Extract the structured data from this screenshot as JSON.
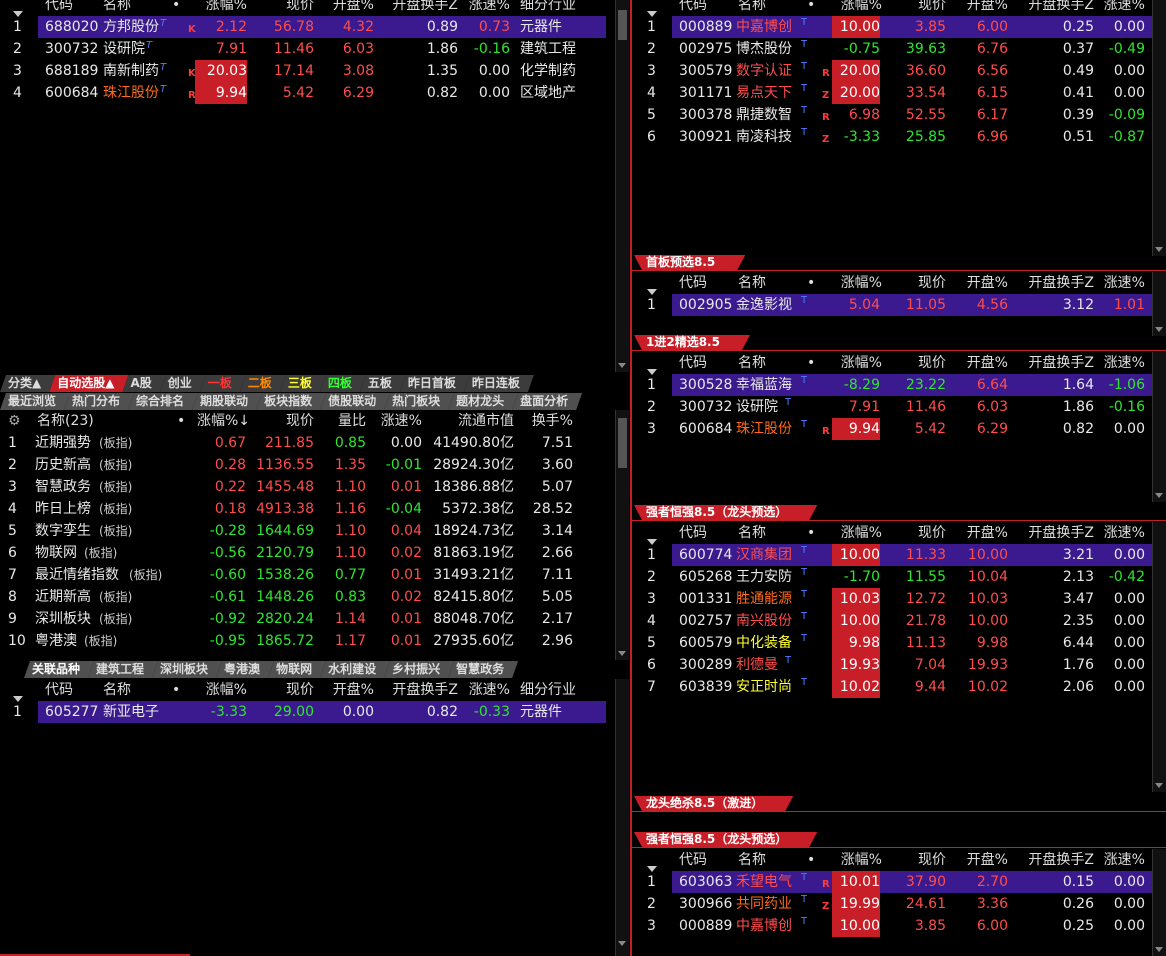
{
  "headers": {
    "code": "代码",
    "name": "名称",
    "dot": "•",
    "chg": "涨幅%",
    "price": "现价",
    "open": "开盘%",
    "turnover": "开盘换手Z",
    "speed": "涨速%",
    "industry": "细分行业"
  },
  "topLeft": {
    "rows": [
      {
        "idx": "1",
        "code": "688020",
        "name": "方邦股份",
        "flag": "K",
        "chg": "2.12",
        "price": "56.78",
        "open": "4.32",
        "turnover": "0.89",
        "speed": "0.73",
        "industry": "元器件"
      },
      {
        "idx": "2",
        "code": "300732",
        "name": "设研院",
        "flag": "",
        "chg": "7.91",
        "price": "11.46",
        "open": "6.03",
        "turnover": "1.86",
        "speed": "-0.16",
        "industry": "建筑工程"
      },
      {
        "idx": "3",
        "code": "688189",
        "name": "南新制药",
        "flag": "K",
        "chg": "20.03",
        "price": "17.14",
        "open": "3.08",
        "turnover": "1.35",
        "speed": "0.00",
        "industry": "化学制药"
      },
      {
        "idx": "4",
        "code": "600684",
        "name": "珠江股份",
        "flag": "R",
        "chg": "9.94",
        "price": "5.42",
        "open": "6.29",
        "turnover": "0.82",
        "speed": "0.00",
        "industry": "区域地产"
      }
    ]
  },
  "tabs1": [
    "分类▲",
    "自动选股▲",
    "A股",
    "创业",
    "一板",
    "二板",
    "三板",
    "四板",
    "五板",
    "昨日首板",
    "昨日连板"
  ],
  "tabs2": [
    "最近浏览",
    "热门分布",
    "综合排名",
    "期股联动",
    "板块指数",
    "债股联动",
    "热门板块",
    "题材龙头",
    "盘面分析"
  ],
  "sector": {
    "header": {
      "name": "名称(23)",
      "dot": "•",
      "chg": "涨幅%↓",
      "price": "现价",
      "ratio": "量比",
      "speed": "涨速%",
      "cap": "流通市值",
      "turn": "换手%"
    },
    "tag": "(板指)",
    "rows": [
      {
        "idx": "1",
        "name": "近期强势",
        "chg": "0.67",
        "price": "211.85",
        "ratio": "0.85",
        "speed": "0.00",
        "cap": "41490.80亿",
        "turn": "7.51"
      },
      {
        "idx": "2",
        "name": "历史新高",
        "chg": "0.28",
        "price": "1136.55",
        "ratio": "1.35",
        "speed": "-0.01",
        "cap": "28924.30亿",
        "turn": "3.60"
      },
      {
        "idx": "3",
        "name": "智慧政务",
        "chg": "0.22",
        "price": "1455.48",
        "ratio": "1.10",
        "speed": "0.01",
        "cap": "18386.88亿",
        "turn": "5.07"
      },
      {
        "idx": "4",
        "name": "昨日上榜",
        "chg": "0.18",
        "price": "4913.38",
        "ratio": "1.16",
        "speed": "-0.04",
        "cap": "5372.38亿",
        "turn": "28.52"
      },
      {
        "idx": "5",
        "name": "数字孪生",
        "chg": "-0.28",
        "price": "1644.69",
        "ratio": "1.10",
        "speed": "0.04",
        "cap": "18924.73亿",
        "turn": "3.14"
      },
      {
        "idx": "6",
        "name": "物联网",
        "chg": "-0.56",
        "price": "2120.79",
        "ratio": "1.10",
        "speed": "0.02",
        "cap": "81863.19亿",
        "turn": "2.66"
      },
      {
        "idx": "7",
        "name": "最近情绪指数",
        "chg": "-0.60",
        "price": "1538.26",
        "ratio": "0.77",
        "speed": "0.01",
        "cap": "31493.21亿",
        "turn": "7.11"
      },
      {
        "idx": "8",
        "name": "近期新高",
        "chg": "-0.61",
        "price": "1448.26",
        "ratio": "0.83",
        "speed": "0.02",
        "cap": "82415.80亿",
        "turn": "5.05"
      },
      {
        "idx": "9",
        "name": "深圳板块",
        "chg": "-0.92",
        "price": "2820.24",
        "ratio": "1.14",
        "speed": "0.01",
        "cap": "88048.70亿",
        "turn": "2.17"
      },
      {
        "idx": "10",
        "name": "粤港澳",
        "chg": "-0.95",
        "price": "1865.72",
        "ratio": "1.17",
        "speed": "0.01",
        "cap": "27935.60亿",
        "turn": "2.96"
      }
    ]
  },
  "tabs3": [
    "关联品种",
    "建筑工程",
    "深圳板块",
    "粤港澳",
    "物联网",
    "水利建设",
    "乡村振兴",
    "智慧政务"
  ],
  "bottomLeft": {
    "rows": [
      {
        "idx": "1",
        "code": "605277",
        "name": "新亚电子",
        "chg": "-3.33",
        "price": "29.00",
        "open": "0.00",
        "turnover": "0.82",
        "speed": "-0.33",
        "industry": "元器件"
      }
    ]
  },
  "rt1": {
    "rows": [
      {
        "idx": "1",
        "code": "000889",
        "name": "中嘉博创",
        "flag": "",
        "chg": "10.00",
        "price": "3.85",
        "open": "6.00",
        "turnover": "0.25",
        "speed": "0.00"
      },
      {
        "idx": "2",
        "code": "002975",
        "name": "博杰股份",
        "flag": "",
        "chg": "-0.75",
        "price": "39.63",
        "open": "6.76",
        "turnover": "0.37",
        "speed": "-0.49"
      },
      {
        "idx": "3",
        "code": "300579",
        "name": "数字认证",
        "flag": "R",
        "chg": "20.00",
        "price": "36.60",
        "open": "6.56",
        "turnover": "0.49",
        "speed": "0.00"
      },
      {
        "idx": "4",
        "code": "301171",
        "name": "易点天下",
        "flag": "Z",
        "chg": "20.00",
        "price": "33.54",
        "open": "6.15",
        "turnover": "0.41",
        "speed": "0.00"
      },
      {
        "idx": "5",
        "code": "300378",
        "name": "鼎捷数智",
        "flag": "R",
        "chg": "6.98",
        "price": "52.55",
        "open": "6.17",
        "turnover": "0.39",
        "speed": "-0.09"
      },
      {
        "idx": "6",
        "code": "300921",
        "name": "南凌科技",
        "flag": "Z",
        "chg": "-3.33",
        "price": "25.85",
        "open": "6.96",
        "turnover": "0.51",
        "speed": "-0.87"
      }
    ]
  },
  "rt2": {
    "title": "首板预选8.5",
    "rows": [
      {
        "idx": "1",
        "code": "002905",
        "name": "金逸影视",
        "flag": "",
        "chg": "5.04",
        "price": "11.05",
        "open": "4.56",
        "turnover": "3.12",
        "speed": "1.01"
      }
    ]
  },
  "rt3": {
    "title": "1进2精选8.5",
    "rows": [
      {
        "idx": "1",
        "code": "300528",
        "name": "幸福蓝海",
        "flag": "",
        "chg": "-8.29",
        "price": "23.22",
        "open": "6.64",
        "turnover": "1.64",
        "speed": "-1.06"
      },
      {
        "idx": "2",
        "code": "300732",
        "name": "设研院",
        "flag": "",
        "chg": "7.91",
        "price": "11.46",
        "open": "6.03",
        "turnover": "1.86",
        "speed": "-0.16"
      },
      {
        "idx": "3",
        "code": "600684",
        "name": "珠江股份",
        "flag": "R",
        "chg": "9.94",
        "price": "5.42",
        "open": "6.29",
        "turnover": "0.82",
        "speed": "0.00"
      }
    ]
  },
  "rt4": {
    "title": "强者恒强8.5（龙头预选）",
    "rows": [
      {
        "idx": "1",
        "code": "600774",
        "name": "汉商集团",
        "flag": "",
        "chg": "10.00",
        "price": "11.33",
        "open": "10.00",
        "turnover": "3.21",
        "speed": "0.00"
      },
      {
        "idx": "2",
        "code": "605268",
        "name": "王力安防",
        "flag": "",
        "chg": "-1.70",
        "price": "11.55",
        "open": "10.04",
        "turnover": "2.13",
        "speed": "-0.42"
      },
      {
        "idx": "3",
        "code": "001331",
        "name": "胜通能源",
        "flag": "",
        "chg": "10.03",
        "price": "12.72",
        "open": "10.03",
        "turnover": "3.47",
        "speed": "0.00"
      },
      {
        "idx": "4",
        "code": "002757",
        "name": "南兴股份",
        "flag": "",
        "chg": "10.00",
        "price": "21.78",
        "open": "10.00",
        "turnover": "2.35",
        "speed": "0.00"
      },
      {
        "idx": "5",
        "code": "600579",
        "name": "中化装备",
        "flag": "",
        "chg": "9.98",
        "price": "11.13",
        "open": "9.98",
        "turnover": "6.44",
        "speed": "0.00"
      },
      {
        "idx": "6",
        "code": "300289",
        "name": "利德曼",
        "flag": "",
        "chg": "19.93",
        "price": "7.04",
        "open": "19.93",
        "turnover": "1.76",
        "speed": "0.00"
      },
      {
        "idx": "7",
        "code": "603839",
        "name": "安正时尚",
        "flag": "",
        "chg": "10.02",
        "price": "9.44",
        "open": "10.02",
        "turnover": "2.06",
        "speed": "0.00"
      }
    ]
  },
  "rt5": {
    "title": "龙头绝杀8.5（激进）"
  },
  "rt6": {
    "title": "强者恒强8.5（龙头预选）",
    "rows": [
      {
        "idx": "1",
        "code": "603063",
        "name": "禾望电气",
        "flag": "R",
        "chg": "10.01",
        "price": "37.90",
        "open": "2.70",
        "turnover": "0.15",
        "speed": "0.00"
      },
      {
        "idx": "2",
        "code": "300966",
        "name": "共同药业",
        "flag": "Z",
        "chg": "19.99",
        "price": "24.61",
        "open": "3.36",
        "turnover": "0.26",
        "speed": "0.00"
      },
      {
        "idx": "3",
        "code": "000889",
        "name": "中嘉博创",
        "flag": "",
        "chg": "10.00",
        "price": "3.85",
        "open": "6.00",
        "turnover": "0.25",
        "speed": "0.00"
      }
    ]
  }
}
